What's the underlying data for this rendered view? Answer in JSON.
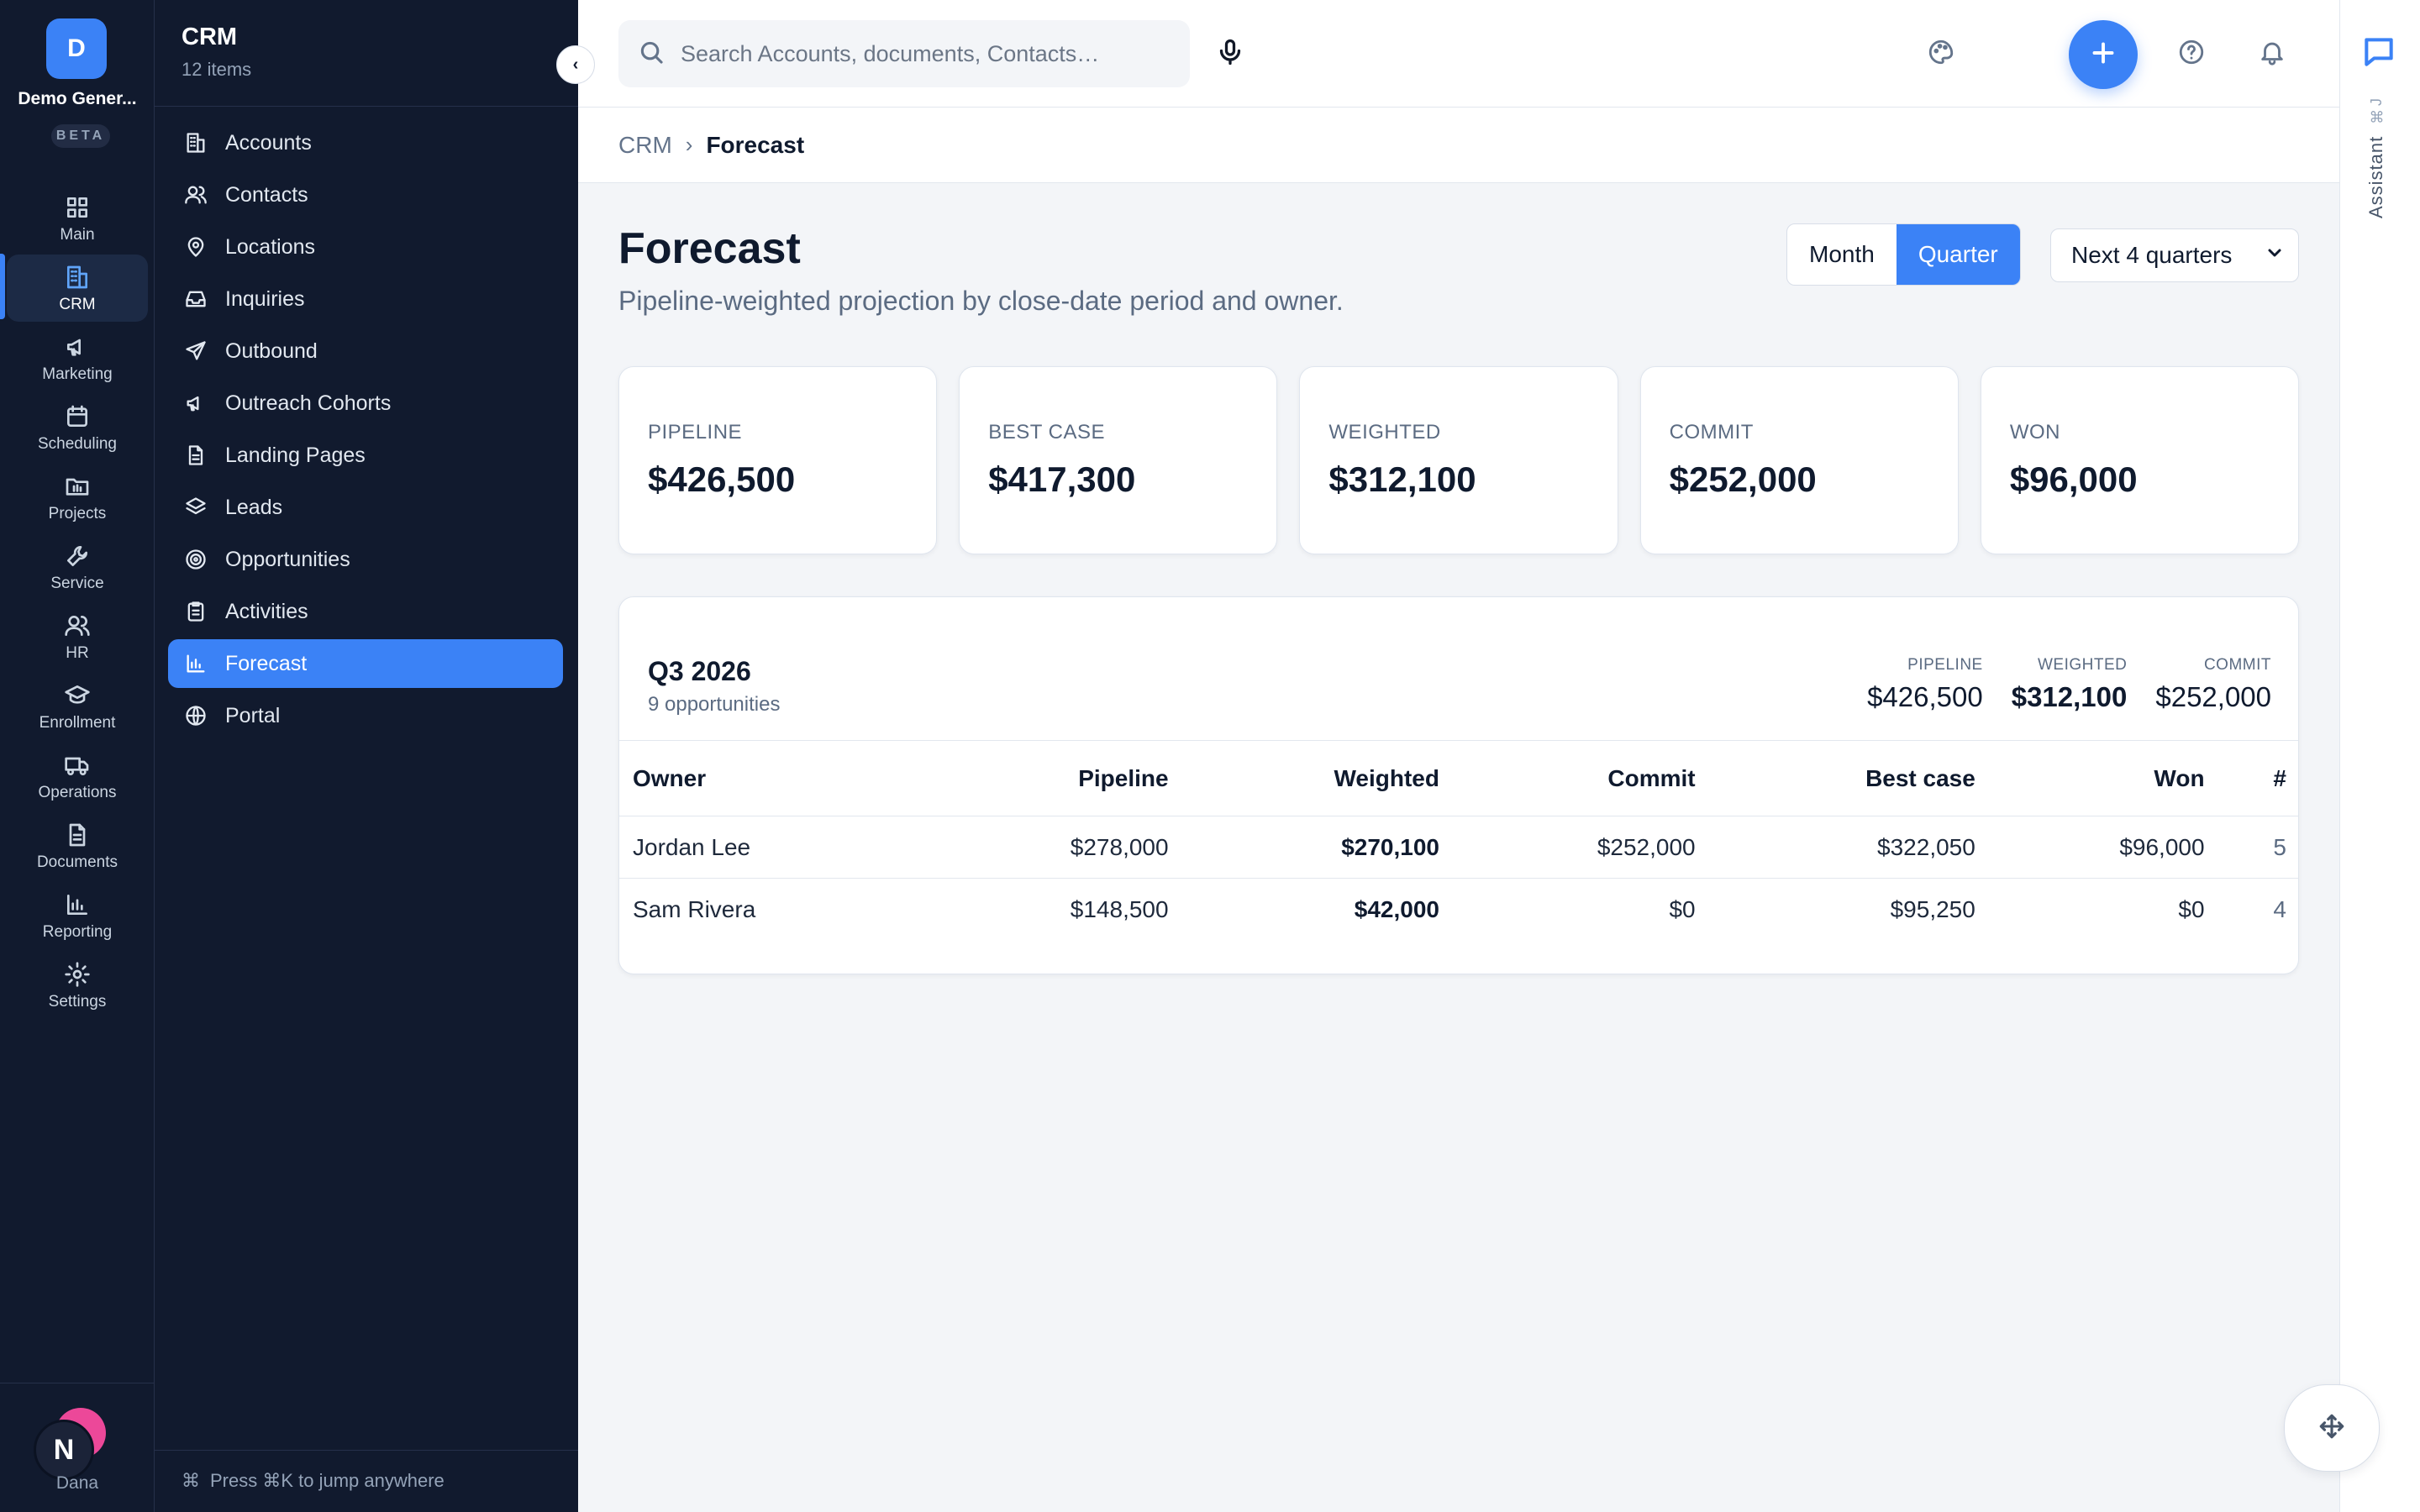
{
  "rail": {
    "logo_letter": "D",
    "org_name": "Demo Gener...",
    "badge": "BETA",
    "items": [
      {
        "label": "Main",
        "icon": "grid-icon"
      },
      {
        "label": "CRM",
        "icon": "building-icon",
        "active": true
      },
      {
        "label": "Marketing",
        "icon": "megaphone-icon"
      },
      {
        "label": "Scheduling",
        "icon": "calendar-icon"
      },
      {
        "label": "Projects",
        "icon": "folder-icon"
      },
      {
        "label": "Service",
        "icon": "wrench-icon"
      },
      {
        "label": "HR",
        "icon": "users-icon"
      },
      {
        "label": "Enrollment",
        "icon": "graduation-cap-icon"
      },
      {
        "label": "Operations",
        "icon": "truck-icon"
      },
      {
        "label": "Documents",
        "icon": "document-icon"
      },
      {
        "label": "Reporting",
        "icon": "bar-chart-icon"
      },
      {
        "label": "Settings",
        "icon": "gear-icon"
      }
    ],
    "user_initial": "N",
    "user_name": "Dana"
  },
  "sidebar": {
    "title": "CRM",
    "count": "12 items",
    "collapse_glyph": "‹",
    "items": [
      {
        "label": "Accounts",
        "icon": "building-icon"
      },
      {
        "label": "Contacts",
        "icon": "users-icon"
      },
      {
        "label": "Locations",
        "icon": "map-pin-icon"
      },
      {
        "label": "Inquiries",
        "icon": "inbox-icon"
      },
      {
        "label": "Outbound",
        "icon": "send-icon"
      },
      {
        "label": "Outreach Cohorts",
        "icon": "megaphone-icon"
      },
      {
        "label": "Landing Pages",
        "icon": "file-icon"
      },
      {
        "label": "Leads",
        "icon": "layers-icon"
      },
      {
        "label": "Opportunities",
        "icon": "target-icon"
      },
      {
        "label": "Activities",
        "icon": "clipboard-icon"
      },
      {
        "label": "Forecast",
        "icon": "bar-chart-icon",
        "active": true
      },
      {
        "label": "Portal",
        "icon": "globe-icon"
      }
    ],
    "footer_key": "⌘",
    "footer": "Press ⌘K to jump anywhere"
  },
  "topbar": {
    "search_placeholder": "Search Accounts, documents, Contacts…"
  },
  "assistant": {
    "label": "Assistant",
    "shortcut": "⌘J"
  },
  "breadcrumb": {
    "parent": "CRM",
    "separator": "›",
    "current": "Forecast"
  },
  "page": {
    "title": "Forecast",
    "subtitle": "Pipeline-weighted projection by close-date period and owner.",
    "granularity": {
      "options": [
        "Month",
        "Quarter"
      ],
      "selected": "Quarter"
    },
    "range": "Next 4 quarters"
  },
  "kpis": [
    {
      "label": "PIPELINE",
      "value": "$426,500"
    },
    {
      "label": "BEST CASE",
      "value": "$417,300"
    },
    {
      "label": "WEIGHTED",
      "value": "$312,100"
    },
    {
      "label": "COMMIT",
      "value": "$252,000"
    },
    {
      "label": "WON",
      "value": "$96,000"
    }
  ],
  "period": {
    "title": "Q3 2026",
    "subtitle": "9 opportunities",
    "summary": [
      {
        "label": "PIPELINE",
        "value": "$426,500"
      },
      {
        "label": "WEIGHTED",
        "value": "$312,100"
      },
      {
        "label": "COMMIT",
        "value": "$252,000"
      }
    ],
    "columns": [
      "Owner",
      "Pipeline",
      "Weighted",
      "Commit",
      "Best case",
      "Won",
      "#"
    ],
    "rows": [
      [
        "Jordan Lee",
        "$278,000",
        "$270,100",
        "$252,000",
        "$322,050",
        "$96,000",
        "5"
      ],
      [
        "Sam Rivera",
        "$148,500",
        "$42,000",
        "$0",
        "$95,250",
        "$0",
        "4"
      ]
    ]
  },
  "colors": {
    "accent": "#3b82f6",
    "sidebar_bg": "#111a2e",
    "page_bg": "#f3f5f8"
  }
}
